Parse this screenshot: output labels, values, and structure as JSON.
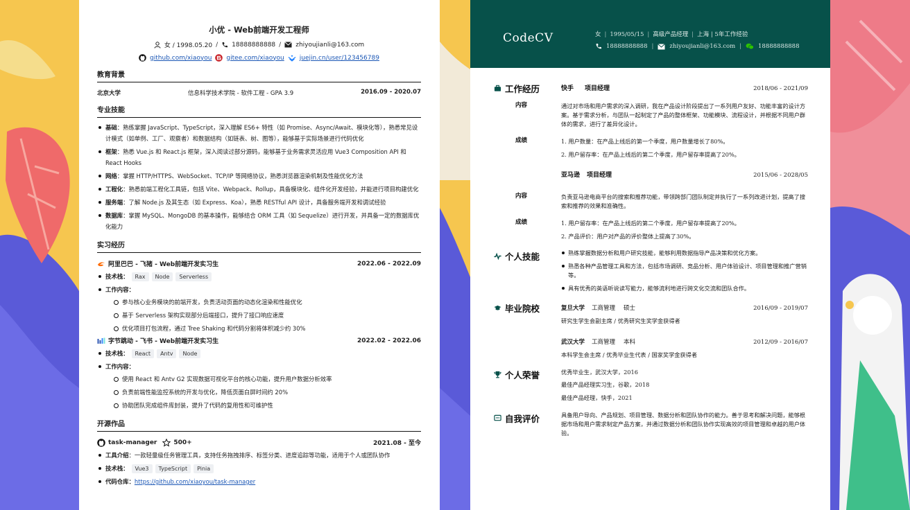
{
  "left": {
    "name_title": "小优 - Web前端开发工程师",
    "gender_birth": "女 / 1998.05.20",
    "phone": "18888888888",
    "email": "zhiyoujianli@163.com",
    "sep": "/",
    "github": "github.com/xiaoyou",
    "gitee": "gitee.com/xiaoyou",
    "juejin": "juejin.cn/user/123456789",
    "edu": {
      "title": "教育背景",
      "school": "北京大学",
      "detail": "信息科学技术学院 - 软件工程 - GPA 3.9",
      "period": "2016.09 - 2020.07"
    },
    "skills": {
      "title": "专业技能",
      "items": [
        {
          "label": "基础",
          "text": "：熟练掌握 JavaScript、TypeScript，深入理解 ES6+ 特性（如 Promise、Async/Await、模块化等），熟悉常见设计模式（如单例、工厂、观察者）和数据结构（如链表、树、图等），能够基于实际场景进行代码优化"
        },
        {
          "label": "框架",
          "text": "：熟悉 Vue.js 和 React.js 框架，深入阅读过部分源码，能够基于业务需求灵活应用 Vue3 Composition API 和 React Hooks"
        },
        {
          "label": "网络",
          "text": "：掌握 HTTP/HTTPS、WebSocket、TCP/IP 等网络协议，熟悉浏览器渲染机制及性能优化方法"
        },
        {
          "label": "工程化",
          "text": "：熟悉前端工程化工具链，包括 Vite、Webpack、Rollup，具备模块化、组件化开发经验，并能进行项目构建优化"
        },
        {
          "label": "服务端",
          "text": "：了解 Node.js 及其生态（如 Express、Koa），熟悉 RESTful API 设计，具备服务端开发和调试经验"
        },
        {
          "label": "数据库",
          "text": "：掌握 MySQL、MongoDB 的基本操作，能够结合 ORM 工具（如 Sequelize）进行开发，并具备一定的数据库优化能力"
        }
      ]
    },
    "intern": {
      "title": "实习经历",
      "stack_label": "技术栈",
      "content_label": "工作内容",
      "colon": "：",
      "jobs": [
        {
          "company": "阿里巴巴 - 飞猪 - Web前端开发实习生",
          "period": "2022.06 - 2022.09",
          "tags": [
            "Rax",
            "Node",
            "Serverless"
          ],
          "items": [
            "参与核心业务模块的前端开发，负责活动页面的动态化渲染和性能优化",
            "基于 Serverless 架构实现部分后端接口，提升了接口响应速度",
            "优化项目打包流程，通过 Tree Shaking 和代码分割将体积减少约 30%"
          ]
        },
        {
          "company": "字节跳动 - 飞书 - Web前端开发实习生",
          "period": "2022.02 - 2022.06",
          "tags": [
            "React",
            "Antv",
            "Node"
          ],
          "items": [
            "使用 React 和 Antv G2 实现数据可视化平台的核心功能，提升用户数据分析效率",
            "负责前端性能监控系统的开发与优化，降低页面白屏时间约 20%",
            "协助团队完成组件库封装，提升了代码的复用性和可维护性"
          ]
        }
      ]
    },
    "opensource": {
      "title": "开源作品",
      "name": "task-manager",
      "stars": "500+",
      "period": "2021.08 - 至今",
      "intro_label": "工具介绍",
      "intro": "：一款轻量级任务管理工具，支持任务拖拽排序、标签分类、进度追踪等功能，适用于个人或团队协作",
      "stack_label": "技术栈",
      "tags": [
        "Vue3",
        "TypeScript",
        "Pinia"
      ],
      "repo_label": "代码仓库",
      "colon": "：",
      "repo": "https://github.com/xiaoyou/task-manager"
    }
  },
  "right": {
    "logo": "CodeCV",
    "info1": [
      "女",
      "1995/05/15",
      "高级产品经理",
      "上海 | 5年工作经验"
    ],
    "info_sep": "|",
    "phone": "18888888888",
    "email": "zhiyoujianli@163.com",
    "wechat": "18888888888",
    "work": {
      "title": "工作经历",
      "content_label": "内容",
      "result_label": "成绩",
      "jobs": [
        {
          "company": "快手",
          "role": "项目经理",
          "period": "2018/06 - 2021/09",
          "content": "通过对市场和用户需求的深入调研，我在产品设计阶段提出了一系列用户友好、功能丰富的设计方案。基于需求分析，与团队一起制定了产品的整体框架、功能模块、流程设计，并根据不同用户群体的需求，进行了差异化设计。",
          "results": [
            "1. 用户数量：在产品上线后的第一个季度，用户数量增长了80%。",
            "2. 用户留存率：在产品上线后的第二个季度，用户留存率提高了20%。"
          ]
        },
        {
          "company": "亚马逊",
          "role": "项目经理",
          "period": "2015/06 - 2028/05",
          "content": "负责亚马逊电商平台的搜索和推荐功能，带领跨部门团队制定并执行了一系列改进计划，提高了搜索和推荐的效果和准确性。",
          "results": [
            "1. 用户留存率：在产品上线后的第二个季度，用户留存率提高了20%。",
            "2. 产品评价：用户对产品的评价整体上提高了30%。"
          ]
        }
      ]
    },
    "skills": {
      "title": "个人技能",
      "items": [
        "熟练掌握数据分析和用户研究技能，能够利用数据指导产品决策和优化方案。",
        "熟悉各种产品管理工具和方法，包括市场调研、竞品分析、用户体验设计、项目管理和推广营销等。",
        "具有优秀的英语听说读写能力，能够流利地进行跨文化交流和团队合作。"
      ]
    },
    "education": {
      "title": "毕业院校",
      "schools": [
        {
          "school": "复旦大学",
          "major": "工商管理",
          "degree": "硕士",
          "period": "2016/09 - 2019/07",
          "note": "研究生学生会副主席 / 优秀研究生奖学金获得者"
        },
        {
          "school": "武汉大学",
          "major": "工商管理",
          "degree": "本科",
          "period": "2012/09 - 2016/07",
          "note": "本科学生会主席 / 优秀毕业生代表 / 国家奖学金获得者"
        }
      ]
    },
    "honors": {
      "title": "个人荣誉",
      "items": [
        "优秀毕业生，武汉大学，2016",
        "最佳产品经理实习生，谷歌，2018",
        "最佳产品经理，快手，2021"
      ]
    },
    "self": {
      "title": "自我评价",
      "text": "具备用户导向、产品规划、项目管理、数据分析和团队协作的能力。善于思考和解决问题，能够根据市场和用户需求制定产品方案，并通过数据分析和团队协作实现高效的项目管理和卓越的用户体验。"
    }
  }
}
